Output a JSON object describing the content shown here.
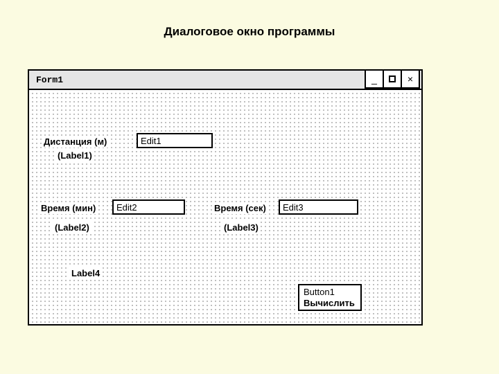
{
  "page": {
    "title": "Диалоговое окно программы"
  },
  "window": {
    "title": "Form1",
    "controls": {
      "minimize": "_",
      "close": "×"
    }
  },
  "labels": {
    "distance": "Дистанция (м)",
    "distance_sub": "(Label1)",
    "time_min": "Время (мин)",
    "time_min_sub": "(Label2)",
    "time_sec": "Время (сек)",
    "time_sec_sub": "(Label3)",
    "label4": "Label4"
  },
  "edits": {
    "edit1": "Edit1",
    "edit2": "Edit2",
    "edit3": "Edit3"
  },
  "button": {
    "name": "Button1",
    "caption": "Вычислить"
  }
}
